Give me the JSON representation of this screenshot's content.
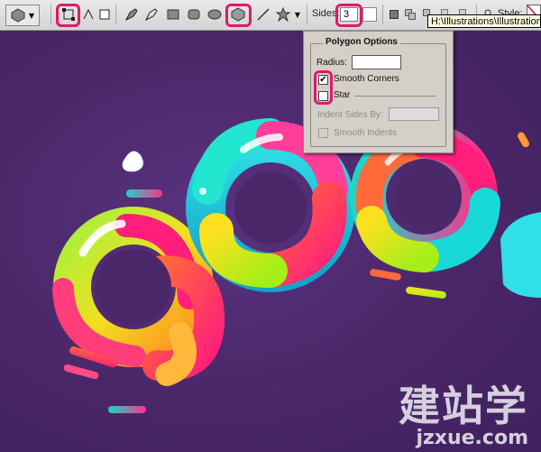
{
  "toolbar": {
    "sides_label": "Sides:",
    "sides_value": "3",
    "style_label": "Style:"
  },
  "tooltip": {
    "text": "H:\\Illustrations\\Illustrations"
  },
  "polygon_options": {
    "title": "Polygon Options",
    "radius_label": "Radius:",
    "radius_value": "",
    "smooth_corners_label": "Smooth Corners",
    "smooth_corners_checked": true,
    "star_label": "Star",
    "star_checked": false,
    "indent_label": "Indent Sides By:",
    "indent_value": "",
    "smooth_indents_label": "Smooth Indents",
    "smooth_indents_checked": false
  },
  "watermark": {
    "chinese": "建站学",
    "url": "jzxue.com"
  },
  "colors": {
    "highlight": "#e0196b",
    "canvas_bg": "#4a2768"
  },
  "icons": [
    "polygon-preset-icon",
    "shape-layers-icon",
    "paths-icon",
    "fill-pixels-icon",
    "pen-icon",
    "freeform-pen-icon",
    "rectangle-icon",
    "rounded-rectangle-icon",
    "ellipse-icon",
    "polygon-icon",
    "line-icon",
    "custom-shape-icon",
    "options-arrow-icon"
  ]
}
